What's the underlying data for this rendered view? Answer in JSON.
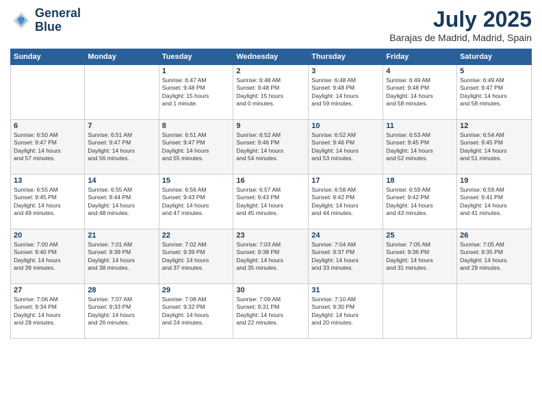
{
  "logo": {
    "line1": "General",
    "line2": "Blue"
  },
  "title": "July 2025",
  "location": "Barajas de Madrid, Madrid, Spain",
  "days_of_week": [
    "Sunday",
    "Monday",
    "Tuesday",
    "Wednesday",
    "Thursday",
    "Friday",
    "Saturday"
  ],
  "weeks": [
    [
      {
        "day": "",
        "info": ""
      },
      {
        "day": "",
        "info": ""
      },
      {
        "day": "1",
        "info": "Sunrise: 6:47 AM\nSunset: 9:48 PM\nDaylight: 15 hours\nand 1 minute."
      },
      {
        "day": "2",
        "info": "Sunrise: 6:48 AM\nSunset: 9:48 PM\nDaylight: 15 hours\nand 0 minutes."
      },
      {
        "day": "3",
        "info": "Sunrise: 6:48 AM\nSunset: 9:48 PM\nDaylight: 14 hours\nand 59 minutes."
      },
      {
        "day": "4",
        "info": "Sunrise: 6:49 AM\nSunset: 9:48 PM\nDaylight: 14 hours\nand 58 minutes."
      },
      {
        "day": "5",
        "info": "Sunrise: 6:49 AM\nSunset: 9:47 PM\nDaylight: 14 hours\nand 58 minutes."
      }
    ],
    [
      {
        "day": "6",
        "info": "Sunrise: 6:50 AM\nSunset: 9:47 PM\nDaylight: 14 hours\nand 57 minutes."
      },
      {
        "day": "7",
        "info": "Sunrise: 6:51 AM\nSunset: 9:47 PM\nDaylight: 14 hours\nand 56 minutes."
      },
      {
        "day": "8",
        "info": "Sunrise: 6:51 AM\nSunset: 9:47 PM\nDaylight: 14 hours\nand 55 minutes."
      },
      {
        "day": "9",
        "info": "Sunrise: 6:52 AM\nSunset: 9:46 PM\nDaylight: 14 hours\nand 54 minutes."
      },
      {
        "day": "10",
        "info": "Sunrise: 6:52 AM\nSunset: 9:46 PM\nDaylight: 14 hours\nand 53 minutes."
      },
      {
        "day": "11",
        "info": "Sunrise: 6:53 AM\nSunset: 9:45 PM\nDaylight: 14 hours\nand 52 minutes."
      },
      {
        "day": "12",
        "info": "Sunrise: 6:54 AM\nSunset: 9:45 PM\nDaylight: 14 hours\nand 51 minutes."
      }
    ],
    [
      {
        "day": "13",
        "info": "Sunrise: 6:55 AM\nSunset: 9:45 PM\nDaylight: 14 hours\nand 49 minutes."
      },
      {
        "day": "14",
        "info": "Sunrise: 6:55 AM\nSunset: 9:44 PM\nDaylight: 14 hours\nand 48 minutes."
      },
      {
        "day": "15",
        "info": "Sunrise: 6:56 AM\nSunset: 9:43 PM\nDaylight: 14 hours\nand 47 minutes."
      },
      {
        "day": "16",
        "info": "Sunrise: 6:57 AM\nSunset: 9:43 PM\nDaylight: 14 hours\nand 45 minutes."
      },
      {
        "day": "17",
        "info": "Sunrise: 6:58 AM\nSunset: 9:42 PM\nDaylight: 14 hours\nand 44 minutes."
      },
      {
        "day": "18",
        "info": "Sunrise: 6:59 AM\nSunset: 9:42 PM\nDaylight: 14 hours\nand 43 minutes."
      },
      {
        "day": "19",
        "info": "Sunrise: 6:59 AM\nSunset: 9:41 PM\nDaylight: 14 hours\nand 41 minutes."
      }
    ],
    [
      {
        "day": "20",
        "info": "Sunrise: 7:00 AM\nSunset: 9:40 PM\nDaylight: 14 hours\nand 39 minutes."
      },
      {
        "day": "21",
        "info": "Sunrise: 7:01 AM\nSunset: 9:39 PM\nDaylight: 14 hours\nand 38 minutes."
      },
      {
        "day": "22",
        "info": "Sunrise: 7:02 AM\nSunset: 9:39 PM\nDaylight: 14 hours\nand 37 minutes."
      },
      {
        "day": "23",
        "info": "Sunrise: 7:03 AM\nSunset: 9:38 PM\nDaylight: 14 hours\nand 35 minutes."
      },
      {
        "day": "24",
        "info": "Sunrise: 7:04 AM\nSunset: 9:37 PM\nDaylight: 14 hours\nand 33 minutes."
      },
      {
        "day": "25",
        "info": "Sunrise: 7:05 AM\nSunset: 9:36 PM\nDaylight: 14 hours\nand 31 minutes."
      },
      {
        "day": "26",
        "info": "Sunrise: 7:05 AM\nSunset: 9:35 PM\nDaylight: 14 hours\nand 29 minutes."
      }
    ],
    [
      {
        "day": "27",
        "info": "Sunrise: 7:06 AM\nSunset: 9:34 PM\nDaylight: 14 hours\nand 28 minutes."
      },
      {
        "day": "28",
        "info": "Sunrise: 7:07 AM\nSunset: 9:33 PM\nDaylight: 14 hours\nand 26 minutes."
      },
      {
        "day": "29",
        "info": "Sunrise: 7:08 AM\nSunset: 9:32 PM\nDaylight: 14 hours\nand 24 minutes."
      },
      {
        "day": "30",
        "info": "Sunrise: 7:09 AM\nSunset: 9:31 PM\nDaylight: 14 hours\nand 22 minutes."
      },
      {
        "day": "31",
        "info": "Sunrise: 7:10 AM\nSunset: 9:30 PM\nDaylight: 14 hours\nand 20 minutes."
      },
      {
        "day": "",
        "info": ""
      },
      {
        "day": "",
        "info": ""
      }
    ]
  ]
}
